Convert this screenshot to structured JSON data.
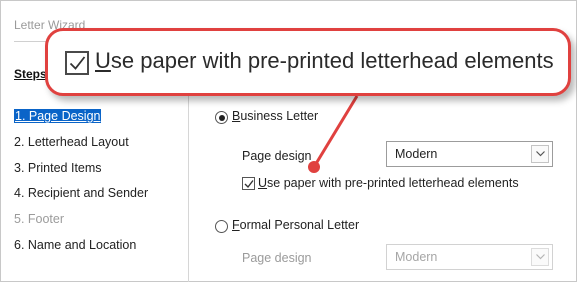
{
  "window": {
    "title": "Letter Wizard"
  },
  "steps": {
    "heading": "Steps",
    "items": [
      {
        "label": "1. Page Design",
        "state": "active"
      },
      {
        "label": "2. Letterhead Layout",
        "state": "normal"
      },
      {
        "label": "3. Printed Items",
        "state": "normal"
      },
      {
        "label": "4. Recipient and Sender",
        "state": "normal"
      },
      {
        "label": "5. Footer",
        "state": "disabled"
      },
      {
        "label": "6. Name and Location",
        "state": "normal"
      }
    ]
  },
  "options": {
    "business": {
      "accel": "B",
      "label_rest": "usiness Letter",
      "selected": true,
      "page_design_label": "Page design",
      "page_design_value": "Modern",
      "letterhead_accel": "U",
      "letterhead_rest": "se paper with pre-printed letterhead elements",
      "letterhead_checked": true
    },
    "formal": {
      "accel": "F",
      "label_rest": "ormal Personal Letter",
      "selected": false,
      "page_design_label": "Page design",
      "page_design_value": "Modern"
    }
  },
  "callout": {
    "accel": "U",
    "text_rest": "se paper with pre-printed letterhead elements",
    "border_color": "#e0413f"
  },
  "colors": {
    "accent": "#0a64c8",
    "highlight": "#e0413f"
  }
}
